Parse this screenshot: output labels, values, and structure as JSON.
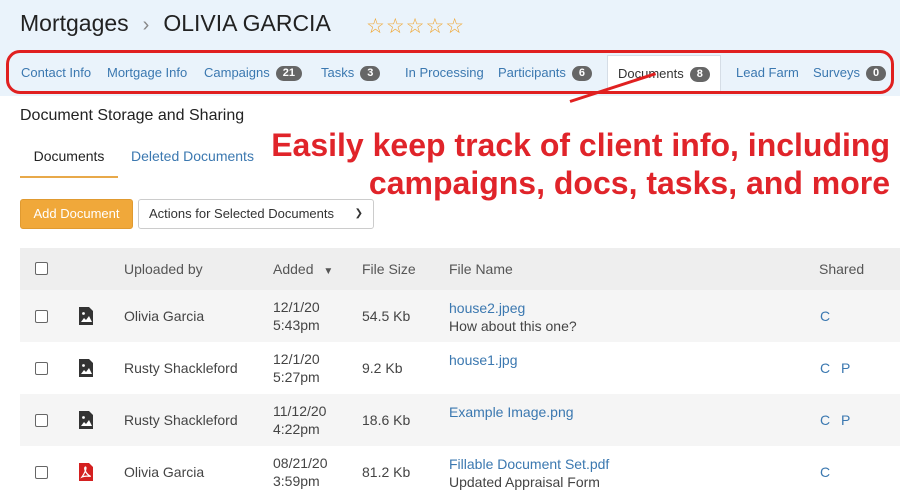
{
  "header": {
    "section": "Mortgages",
    "separator": "›",
    "client_name": "OLIVIA GARCIA",
    "stars": "☆☆☆☆☆"
  },
  "tabs": [
    {
      "label": "Contact Info"
    },
    {
      "label": "Mortgage Info"
    },
    {
      "label": "Campaigns",
      "count": "21"
    },
    {
      "label": "Tasks",
      "count": "3"
    },
    {
      "label": "In Processing"
    },
    {
      "label": "Participants",
      "count": "6"
    },
    {
      "label": "Documents",
      "count": "8"
    },
    {
      "label": "Lead Farm"
    },
    {
      "label": "Surveys",
      "count": "0"
    }
  ],
  "section_title": "Document Storage and Sharing",
  "subtabs": [
    "Documents",
    "Deleted Documents"
  ],
  "annotation": [
    "Easily keep track of client info, including",
    "campaigns, docs, tasks, and more"
  ],
  "buttons": {
    "add_document": "Add Document",
    "actions": "Actions for Selected Documents"
  },
  "table": {
    "headers": {
      "uploaded_by": "Uploaded by",
      "added": "Added",
      "file_size": "File Size",
      "file_name": "File Name",
      "shared": "Shared"
    },
    "rows": [
      {
        "icon": "image-file-icon",
        "uploaded_by": "Olivia Garcia",
        "date": "12/1/20",
        "time": "5:43pm",
        "size": "54.5 Kb",
        "file": "house2.jpeg",
        "note": "How about this one?",
        "shared": [
          "C"
        ]
      },
      {
        "icon": "image-file-icon",
        "uploaded_by": "Rusty Shackleford",
        "date": "12/1/20",
        "time": "5:27pm",
        "size": "9.2 Kb",
        "file": "house1.jpg",
        "note": "",
        "shared": [
          "C",
          "P"
        ]
      },
      {
        "icon": "image-file-icon",
        "uploaded_by": "Rusty Shackleford",
        "date": "11/12/20",
        "time": "4:22pm",
        "size": "18.6 Kb",
        "file": "Example Image.png",
        "note": "",
        "shared": [
          "C",
          "P"
        ]
      },
      {
        "icon": "pdf-file-icon",
        "uploaded_by": "Olivia Garcia",
        "date": "08/21/20",
        "time": "3:59pm",
        "size": "81.2 Kb",
        "file": "Fillable Document Set.pdf",
        "note": "Updated Appraisal Form",
        "shared": [
          "C"
        ]
      }
    ]
  },
  "colors": {
    "accent": "#f0a83a",
    "link": "#3b78b0",
    "annotation": "#e0242a",
    "header_bg": "#eaf3fb"
  }
}
